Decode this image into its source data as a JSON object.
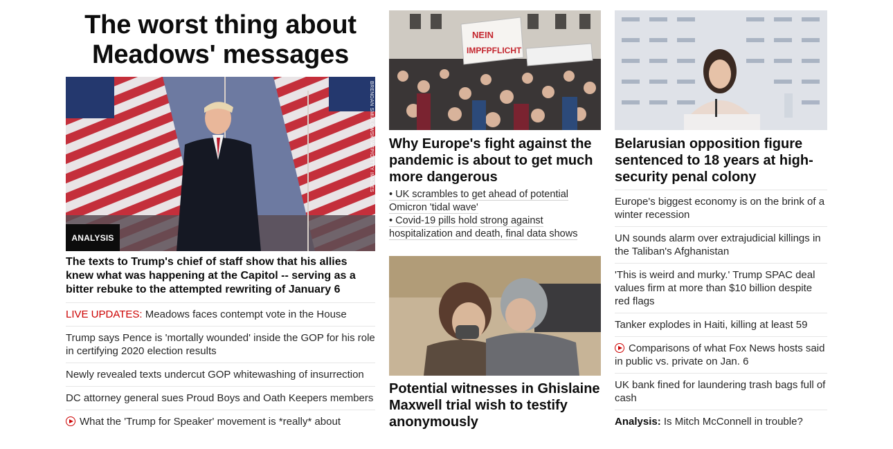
{
  "left": {
    "headline": "The worst thing about Meadows' messages",
    "tag": "ANALYSIS",
    "photo_credit": "BRENDAN SMIALOWSKI/AFP/GETTY IMAGES",
    "description": "The texts to Trump's chief of staff show that his allies knew what was happening at the Capitol -- serving as a bitter rebuke to the attempted rewriting of January 6",
    "items": [
      {
        "prefix": "LIVE UPDATES:",
        "text": "Meadows faces contempt vote in the House"
      },
      {
        "text": "Trump says Pence is 'mortally wounded' inside the GOP for his role in certifying 2020 election results"
      },
      {
        "text": "Newly revealed texts undercut GOP whitewashing of insurrection"
      },
      {
        "text": "DC attorney general sues Proud Boys and Oath Keepers members"
      },
      {
        "icon": "play-icon",
        "text": "What the 'Trump for Speaker' movement is *really* about"
      }
    ]
  },
  "middle": {
    "card1": {
      "sign_text": "NEIN IMPFPFLICHT",
      "title": "Why Europe's fight against the pandemic is about to get much more dangerous",
      "bullets": [
        "• UK scrambles to get ahead of potential Omicron 'tidal wave'",
        "• Covid-19 pills hold strong against hospitalization and death, final data shows"
      ]
    },
    "card2": {
      "title": "Potential witnesses in Ghislaine Maxwell trial wish to testify anonymously"
    }
  },
  "right": {
    "title": "Belarusian opposition figure sentenced to 18 years at high-security penal colony",
    "items": [
      {
        "text": "Europe's biggest economy is on the brink of a winter recession"
      },
      {
        "text": "UN sounds alarm over extrajudicial killings in the Taliban's Afghanistan"
      },
      {
        "text": "'This is weird and murky.' Trump SPAC deal values firm at more than $10 billion despite red flags"
      },
      {
        "text": "Tanker explodes in Haiti, killing at least 59"
      },
      {
        "icon": "play-icon",
        "text": "Comparisons of what Fox News hosts said in public vs. private on Jan. 6"
      },
      {
        "text": "UK bank fined for laundering trash bags full of cash"
      },
      {
        "prefix": "Analysis:",
        "text": "Is Mitch McConnell in trouble?"
      }
    ]
  },
  "colors": {
    "accent_red": "#cc0000",
    "text": "#262626",
    "divider": "#e6e6e6"
  }
}
